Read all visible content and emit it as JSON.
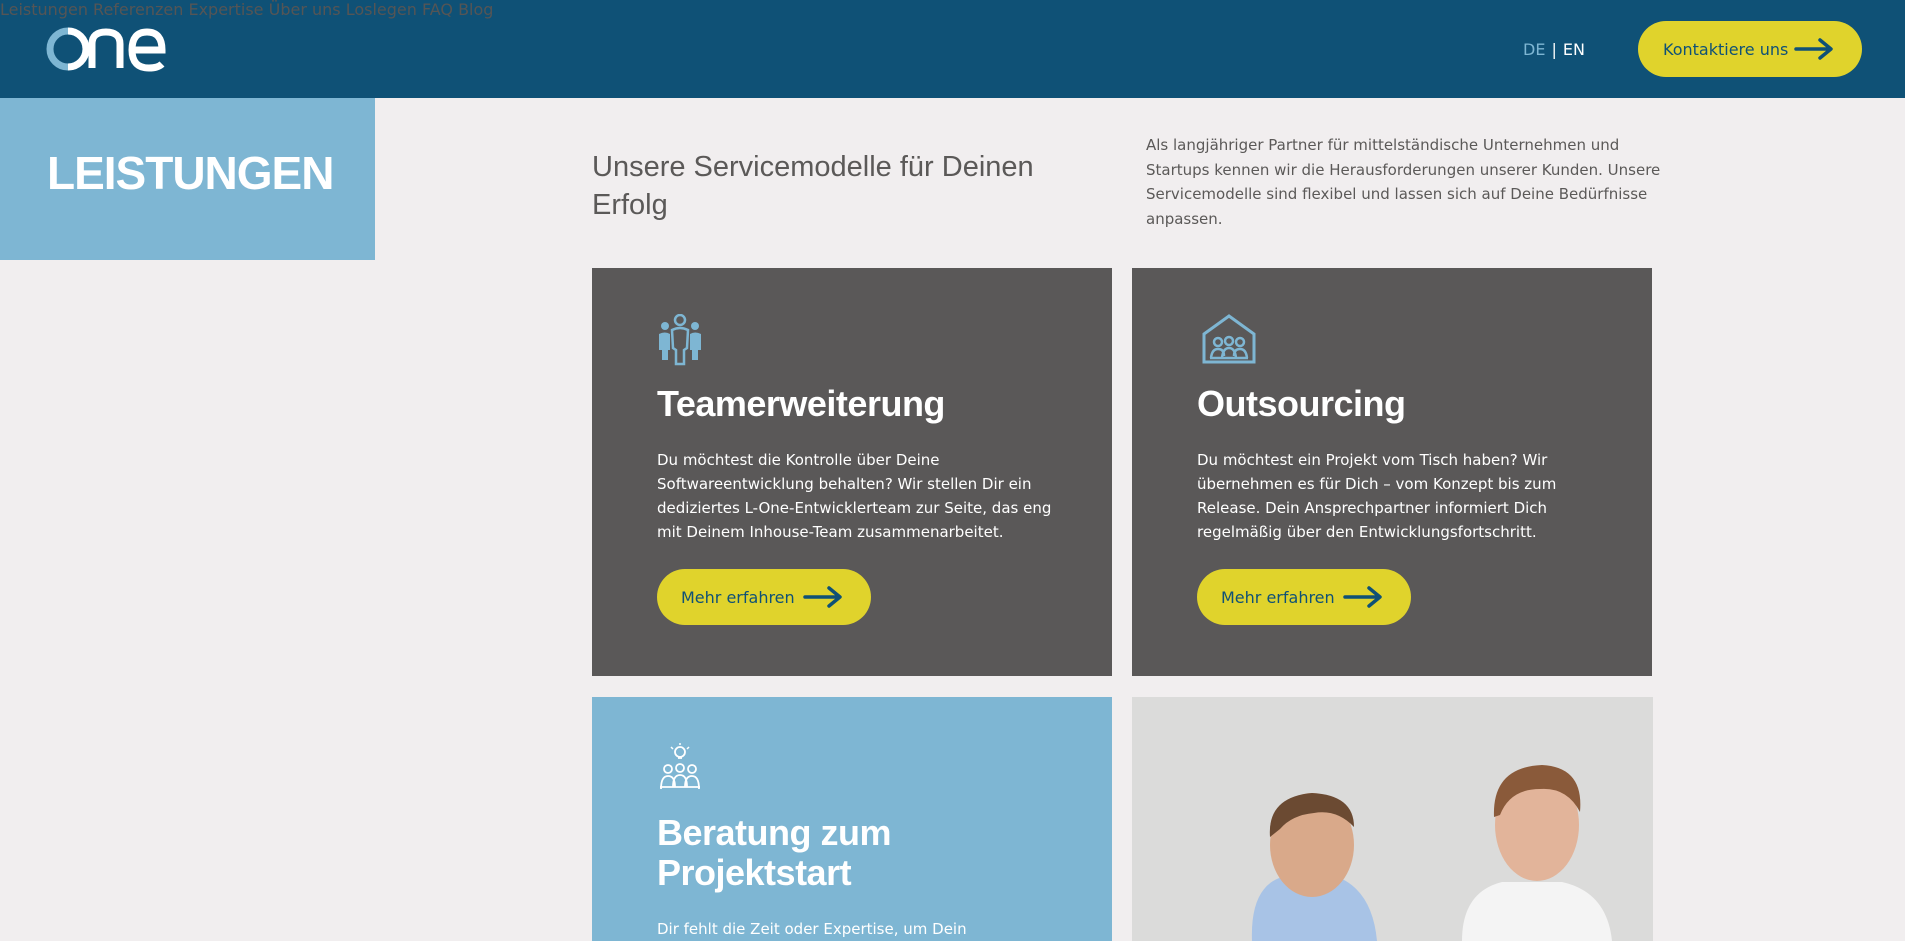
{
  "header": {
    "logo_text": "one",
    "nav": [
      "Leistungen",
      "Referenzen",
      "Expertise",
      "Über uns",
      "Loslegen",
      "FAQ",
      "Blog"
    ],
    "lang_de": "DE",
    "lang_sep": "|",
    "lang_en": "EN",
    "cta_label": "Kontaktiere uns"
  },
  "page": {
    "section_title": "LEISTUNGEN",
    "intro_title": "Unsere Servicemodelle für Deinen Erfolg",
    "intro_text": "Als langjähriger Partner für mittelständische Unternehmen und Startups kennen wir die Herausforderungen unserer Kunden. Unsere Servicemodelle sind flexibel und lassen sich auf Deine Bedürfnisse anpassen."
  },
  "cards": [
    {
      "title": "Teamerweiterung",
      "text": "Du möchtest die Kontrolle über Deine Softwareentwicklung behalten? Wir stellen Dir ein dediziertes L-One-Entwicklerteam zur Seite, das eng mit Deinem Inhouse-Team zusammenarbeitet.",
      "button": "Mehr erfahren",
      "icon": "team-icon"
    },
    {
      "title": "Outsourcing",
      "text": "Du möchtest ein Projekt vom Tisch haben? Wir übernehmen es für Dich – vom Konzept bis zum Release. Dein Ansprechpartner informiert Dich regelmäßig über den Entwicklungsfortschritt.",
      "button": "Mehr erfahren",
      "icon": "house-team-icon"
    },
    {
      "title": "Beratung zum Projektstart",
      "text": "Dir fehlt die Zeit oder Expertise, um Dein",
      "icon": "idea-meeting-icon"
    }
  ],
  "colors": {
    "header_bg": "#0f5176",
    "accent_yellow": "#e0d32c",
    "light_blue": "#7eb6d3",
    "card_dark": "#5a5858",
    "page_bg": "#f1eeef"
  }
}
